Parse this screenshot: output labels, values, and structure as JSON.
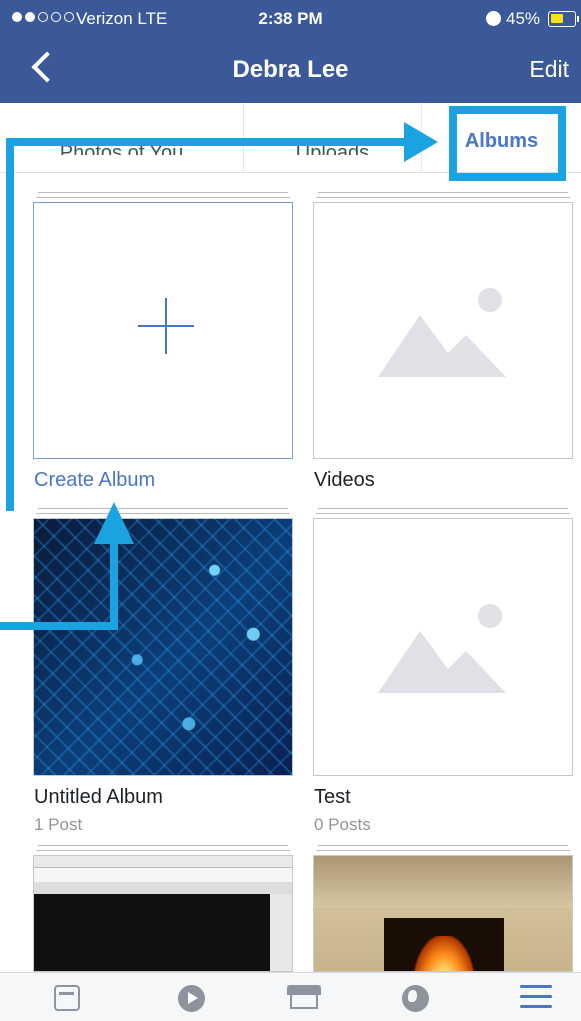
{
  "status_bar": {
    "carrier": "Verizon  LTE",
    "time": "2:38 PM",
    "battery_percent": "45%",
    "battery_level": 0.45,
    "signal_bars_filled": 2,
    "signal_bars_total": 5,
    "icons": [
      "signal-dots-icon",
      "alarm-icon",
      "battery-icon"
    ]
  },
  "nav": {
    "back_icon": "chevron-left-icon",
    "title": "Debra Lee",
    "edit_label": "Edit"
  },
  "tabs": [
    {
      "label": "Photos of You",
      "active": false
    },
    {
      "label": "Uploads",
      "active": false
    },
    {
      "label": "Albums",
      "active": true
    }
  ],
  "albums": [
    {
      "name": "Create Album",
      "count": "",
      "cover": "plus-icon",
      "is_link": true
    },
    {
      "name": "Videos",
      "count": "",
      "cover": "image-placeholder-icon",
      "is_link": false
    },
    {
      "name": "Untitled Album",
      "count": "1 Post",
      "cover": "circuit-photo",
      "is_link": false
    },
    {
      "name": "Test",
      "count": "0 Posts",
      "cover": "image-placeholder-icon",
      "is_link": false
    },
    {
      "name": "",
      "count": "",
      "cover": "browser-screenshot",
      "is_link": false
    },
    {
      "name": "",
      "count": "",
      "cover": "fireplace-photo",
      "is_link": false
    }
  ],
  "bottom_bar": [
    {
      "icon": "news-feed-icon",
      "active": false
    },
    {
      "icon": "video-play-icon",
      "active": false
    },
    {
      "icon": "marketplace-icon",
      "active": false
    },
    {
      "icon": "globe-notifications-icon",
      "active": false
    },
    {
      "icon": "menu-icon",
      "active": true
    }
  ],
  "colors": {
    "nav_blue": "#3b5998",
    "link_blue": "#4a76c6",
    "annotation_arrow": "#1aa3e0",
    "battery_yellow": "#f8e21e",
    "icon_gray": "#8d949e"
  }
}
